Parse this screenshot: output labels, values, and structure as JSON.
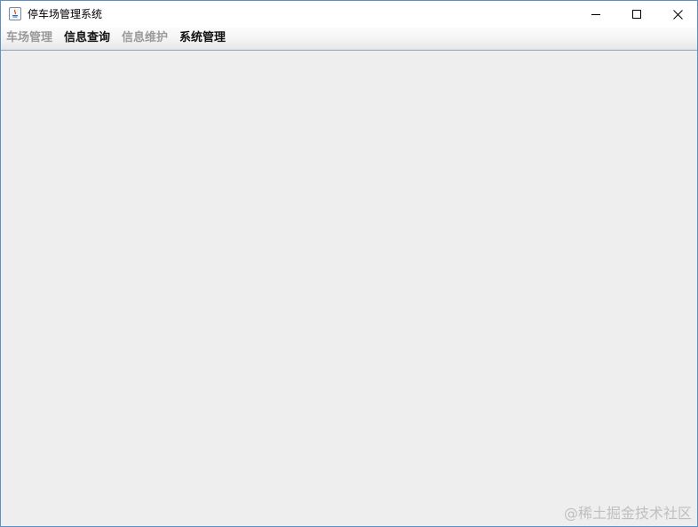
{
  "window": {
    "title": "停车场管理系统",
    "icon": "java-icon",
    "controls": {
      "minimize_icon": "minimize-icon",
      "maximize_icon": "maximize-icon",
      "close_icon": "close-icon"
    }
  },
  "menubar": {
    "items": [
      {
        "label": "车场管理",
        "enabled": false
      },
      {
        "label": "信息查询",
        "enabled": true
      },
      {
        "label": "信息维护",
        "enabled": false
      },
      {
        "label": "系统管理",
        "enabled": true
      }
    ]
  },
  "watermark": {
    "text": "@稀土掘金技术社区"
  },
  "colors": {
    "window_border": "#5a8fc8",
    "content_background": "#eeeeee",
    "menu_disabled": "#9a9a9a",
    "menu_enabled": "#111111"
  }
}
